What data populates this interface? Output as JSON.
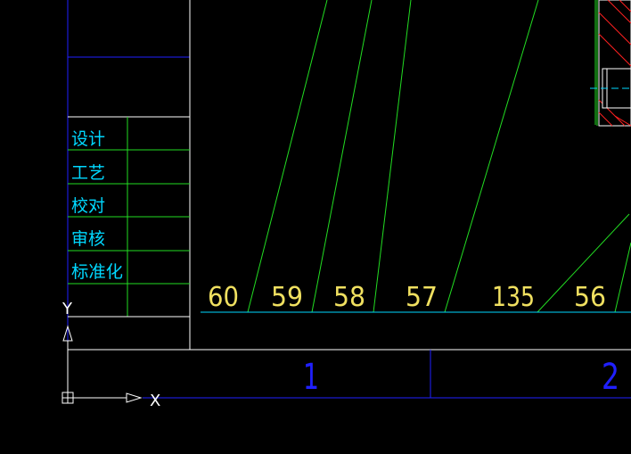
{
  "title_block": {
    "rows": [
      {
        "label": "设计"
      },
      {
        "label": "工艺"
      },
      {
        "label": "校对"
      },
      {
        "label": "审核"
      },
      {
        "label": "标准化"
      }
    ]
  },
  "dimension_labels": [
    "60",
    "59",
    "58",
    "57",
    "135",
    "56"
  ],
  "zone_labels": [
    "1",
    "2"
  ],
  "ucs": {
    "x_label": "X",
    "y_label": "Y"
  },
  "colors": {
    "background": "#000000",
    "white_lines": "#ffffff",
    "blue_lines": "#2020ff",
    "green_lines": "#22dd22",
    "cyan_text": "#00d8ff",
    "yellow_text": "#f0e060",
    "red_hatch": "#ff2020",
    "ucs_white": "#ffffff"
  }
}
